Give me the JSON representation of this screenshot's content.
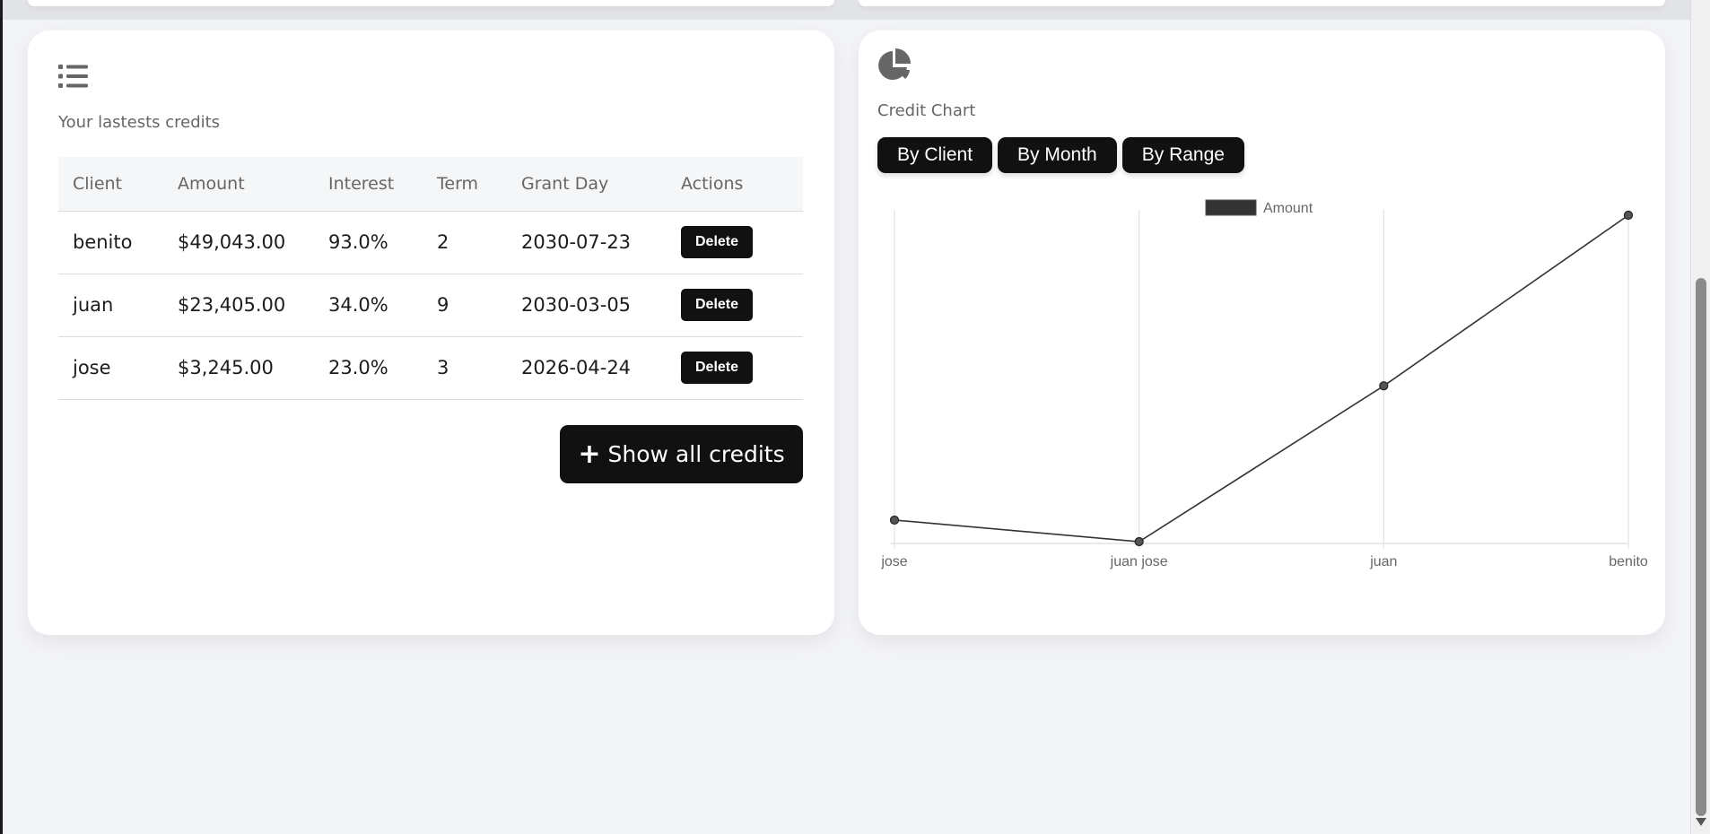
{
  "credits_card": {
    "icon": "list-icon",
    "title": "Your lastests credits",
    "columns": [
      "Client",
      "Amount",
      "Interest",
      "Term",
      "Grant Day",
      "Actions"
    ],
    "rows": [
      {
        "client": "benito",
        "amount": "$49,043.00",
        "interest": "93.0%",
        "term": "2",
        "grant_day": "2030-07-23",
        "action": "Delete"
      },
      {
        "client": "juan",
        "amount": "$23,405.00",
        "interest": "34.0%",
        "term": "9",
        "grant_day": "2030-03-05",
        "action": "Delete"
      },
      {
        "client": "jose",
        "amount": "$3,245.00",
        "interest": "23.0%",
        "term": "3",
        "grant_day": "2026-04-24",
        "action": "Delete"
      }
    ],
    "show_all_label": "Show all credits"
  },
  "chart_card": {
    "icon": "pie-chart-icon",
    "title": "Credit Chart",
    "tabs": [
      "By Client",
      "By Month",
      "By Range"
    ]
  },
  "chart_data": {
    "type": "line",
    "categories": [
      "jose",
      "juan jose",
      "juan",
      "benito"
    ],
    "series": [
      {
        "name": "Amount",
        "values": [
          3245,
          0,
          23405,
          49043
        ]
      }
    ],
    "legend": "top",
    "grid": true,
    "colors": {
      "line": "#333333",
      "legend_fill": "#333333"
    }
  },
  "colors": {
    "button_bg": "#111111",
    "page_bg": "#f3f4f7",
    "card_bg": "#ffffff"
  }
}
